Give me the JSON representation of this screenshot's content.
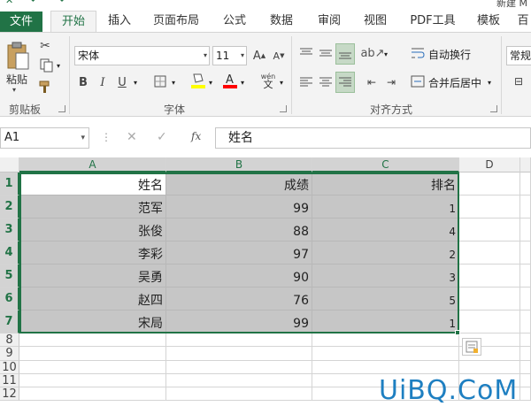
{
  "window": {
    "doc_title": "新建 M"
  },
  "tabs": [
    {
      "label": "文件"
    },
    {
      "label": "开始"
    },
    {
      "label": "插入"
    },
    {
      "label": "页面布局"
    },
    {
      "label": "公式"
    },
    {
      "label": "数据"
    },
    {
      "label": "审阅"
    },
    {
      "label": "视图"
    },
    {
      "label": "PDF工具"
    },
    {
      "label": "模板"
    },
    {
      "label": "百"
    }
  ],
  "ribbon": {
    "clipboard": {
      "paste_label": "粘贴",
      "group_label": "剪贴板"
    },
    "font": {
      "name": "宋体",
      "size": "11",
      "group_label": "字体",
      "bold": "B",
      "italic": "I",
      "underline": "U",
      "phonetic": "wén"
    },
    "alignment": {
      "wrap_label": "自动换行",
      "merge_label": "合并后居中",
      "group_label": "对齐方式"
    },
    "number": {
      "format": "常规"
    }
  },
  "formula_bar": {
    "name_box": "A1",
    "fx": "fx",
    "content": "姓名"
  },
  "sheet": {
    "columns": [
      "A",
      "B",
      "C",
      "D"
    ],
    "rows": [
      "1",
      "2",
      "3",
      "4",
      "5",
      "6",
      "7",
      "8",
      "9",
      "10",
      "11",
      "12"
    ],
    "data": [
      [
        "姓名",
        "成绩",
        "排名"
      ],
      [
        "范军",
        "99",
        "1"
      ],
      [
        "张俊",
        "88",
        "4"
      ],
      [
        "李彩",
        "97",
        "2"
      ],
      [
        "吴勇",
        "90",
        "3"
      ],
      [
        "赵四",
        "76",
        "5"
      ],
      [
        "宋局",
        "99",
        "1"
      ]
    ]
  },
  "watermark": "UiBQ.CoM",
  "colors": {
    "accent": "#217346",
    "selection": "#c6c6c6",
    "ribbon_bg": "#f3f3f3"
  }
}
